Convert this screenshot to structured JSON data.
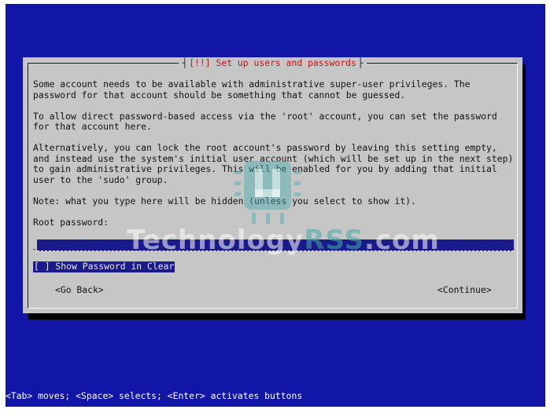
{
  "dialog": {
    "title": "[!!] Set up users and passwords",
    "paragraphs": [
      "Some account needs to be available with administrative super-user privileges. The\npassword for that account should be something that cannot be guessed.",
      "To allow direct password-based access via the 'root' account, you can set the password\nfor that account here.",
      "Alternatively, you can lock the root account's password by leaving this setting empty,\nand instead use the system's initial user account (which will be set up in the next step)\nto gain administrative privileges. This will be enabled for you by adding that initial\nuser to the 'sudo' group.",
      "Note: what you type here will be hidden (unless you select to show it)."
    ],
    "root_password_label": "Root password:",
    "root_password_value": "",
    "show_password_label": "[ ] Show Password in Clear",
    "go_back_label": "<Go Back>",
    "continue_label": "<Continue>"
  },
  "status_bar": "<Tab> moves; <Space> selects; <Enter> activates buttons",
  "watermark": {
    "part1": "Technology",
    "part2": "RSS",
    "part3": ".com"
  },
  "colors": {
    "background": "#1216a6",
    "dialog": "#c6c6c6",
    "title": "#c21515",
    "selected": "#1a1a8e"
  }
}
